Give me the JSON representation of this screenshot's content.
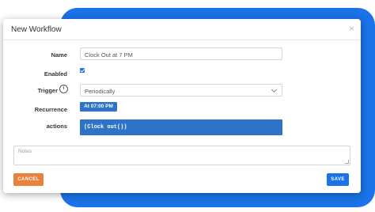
{
  "modal": {
    "title": "New Workflow",
    "close_label": "×"
  },
  "form": {
    "name_label": "Name",
    "name_value": "Clock Out at 7 PM",
    "enabled_label": "Enabled",
    "enabled_checked": true,
    "trigger_label": "Trigger",
    "trigger_info_icon": "i",
    "trigger_value": "Periodically",
    "recurrence_label": "Recurrence",
    "recurrence_value": "At 07:00 PM",
    "actions_label": "actions",
    "actions_value": "(Clock out())",
    "notes_placeholder": "Notes"
  },
  "buttons": {
    "cancel_label": "CANCEL",
    "save_label": "SAVE"
  },
  "colors": {
    "accent": "#1a73e8",
    "badge": "#2d73c8",
    "cancel": "#e8823a"
  }
}
